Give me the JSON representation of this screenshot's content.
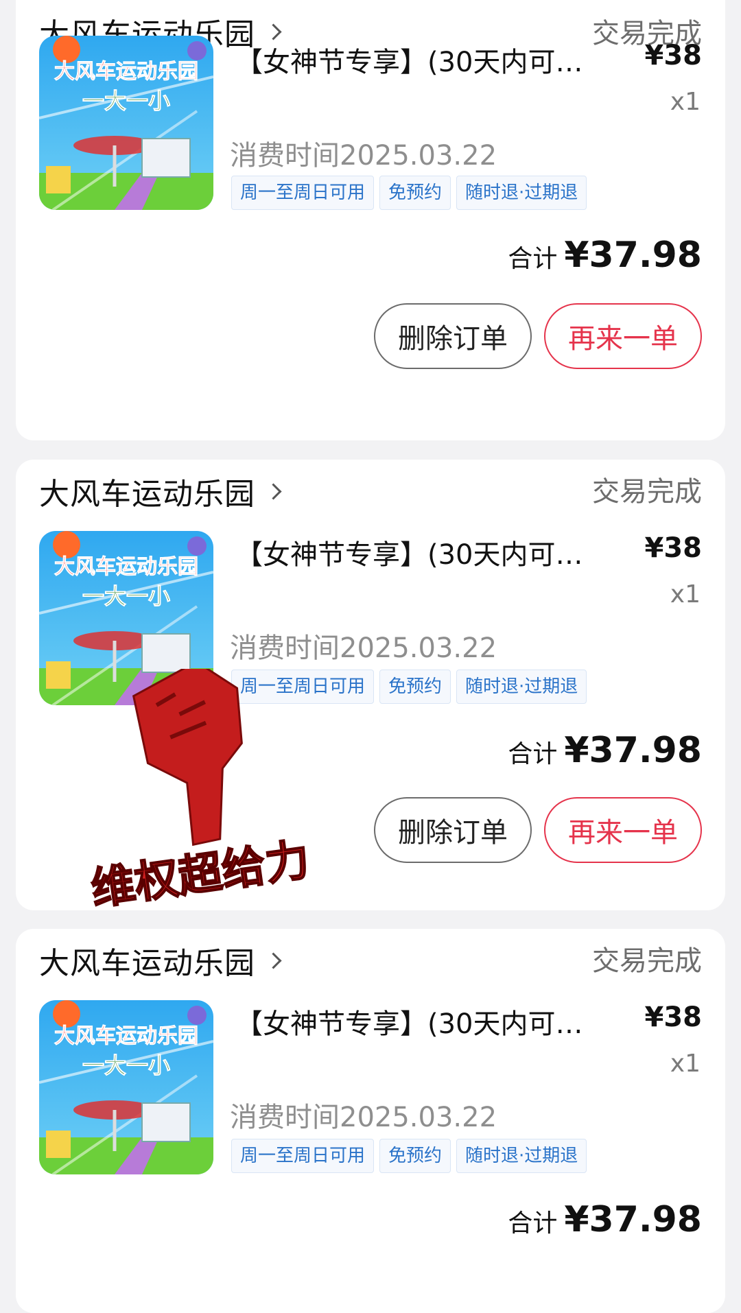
{
  "orders": [
    {
      "shop_name": "大风车运动乐园",
      "status": "交易完成",
      "product_title": "【女神节专享】(30天内可…",
      "price": "¥38",
      "quantity": "x1",
      "consume_time": "消费时间2025.03.22",
      "tags": [
        "周一至周日可用",
        "免预约",
        "随时退·过期退"
      ],
      "total_label": "合计",
      "total_amount": "¥37.98",
      "delete_button": "删除订单",
      "reorder_button": "再来一单",
      "thumbnail_text": [
        "大风车运动乐园",
        "一大一小"
      ]
    },
    {
      "shop_name": "大风车运动乐园",
      "status": "交易完成",
      "product_title": "【女神节专享】(30天内可…",
      "price": "¥38",
      "quantity": "x1",
      "consume_time": "消费时间2025.03.22",
      "tags": [
        "周一至周日可用",
        "免预约",
        "随时退·过期退"
      ],
      "total_label": "合计",
      "total_amount": "¥37.98",
      "delete_button": "删除订单",
      "reorder_button": "再来一单",
      "thumbnail_text": [
        "大风车运动乐园",
        "一大一小"
      ]
    },
    {
      "shop_name": "大风车运动乐园",
      "status": "交易完成",
      "product_title": "【女神节专享】(30天内可…",
      "price": "¥38",
      "quantity": "x1",
      "consume_time": "消费时间2025.03.22",
      "tags": [
        "周一至周日可用",
        "免预约",
        "随时退·过期退"
      ],
      "total_label": "合计",
      "total_amount": "¥37.98",
      "thumbnail_text": [
        "大风车运动乐园",
        "一大一小"
      ]
    }
  ],
  "watermark": {
    "text": "维权超给力",
    "icon": "raised-fist-icon"
  },
  "colors": {
    "accent_red": "#e5334b",
    "tag_blue": "#2a73c9",
    "status_gray": "#6d6d6d",
    "page_bg": "#f2f2f4"
  }
}
